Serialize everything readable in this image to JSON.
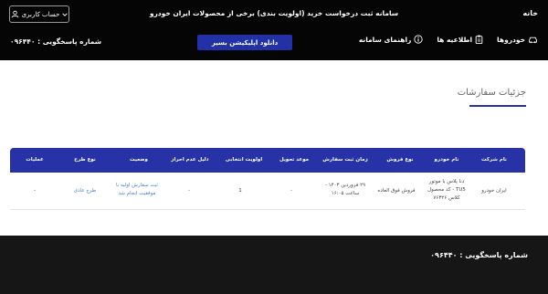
{
  "header": {
    "home_label": "خانه",
    "site_title": "سامانه ثبت درخواست خرید (اولویت بندی) برخی از محصولات ایران خودرو",
    "account_label": "حساب کاربری"
  },
  "nav": {
    "cars_label": "خودروها",
    "notices_label": "اطلاعیه ها",
    "guide_label": "راهنمای سامانه",
    "download_label": "دانلود اپلیکیشن بسیر",
    "support_text": "شماره پاسخگویی : ۰۹۶۴۴۰"
  },
  "main": {
    "section_title": "جزئیات سفارشات"
  },
  "table": {
    "headers": [
      "نام شرکت",
      "نام خودرو",
      "نوع فروش",
      "زمان ثبت سفارش",
      "موعد تحویل",
      "اولویت انتخابی",
      "دلیل عدم احراز",
      "وضعیت",
      "نوع طرح",
      "عملیات"
    ],
    "row": {
      "company": "ایران خودرو",
      "car_line1": "دنا پلاس با موتور",
      "car_line2": "TU5 - کد محصول",
      "car_line3": "کلاس ۷۶۳۲۶",
      "sale_type": "فروش فوق العاده",
      "order_time_line1": "۲۹ فروردین ۱۴۰۳ -",
      "order_time_line2": "ساعت ۱۶:۰۵",
      "delivery": "-",
      "priority": "1",
      "reason": "-",
      "status_line1": "ثبت سفارش اولیه با",
      "status_line2": "موفقیت انجام شد",
      "plan_type": "طرح عادی",
      "actions": "-"
    }
  },
  "footer": {
    "support_text": "شماره پاسخگویی : ۰۹۶۴۴۰"
  },
  "colors": {
    "topbar": "#050505",
    "accent": "#2632a6",
    "link": "#3d7fd6",
    "footer": "#161616"
  },
  "icons": [
    "user-icon",
    "chevron-down-icon",
    "car-icon",
    "clipboard-icon",
    "info-icon"
  ]
}
